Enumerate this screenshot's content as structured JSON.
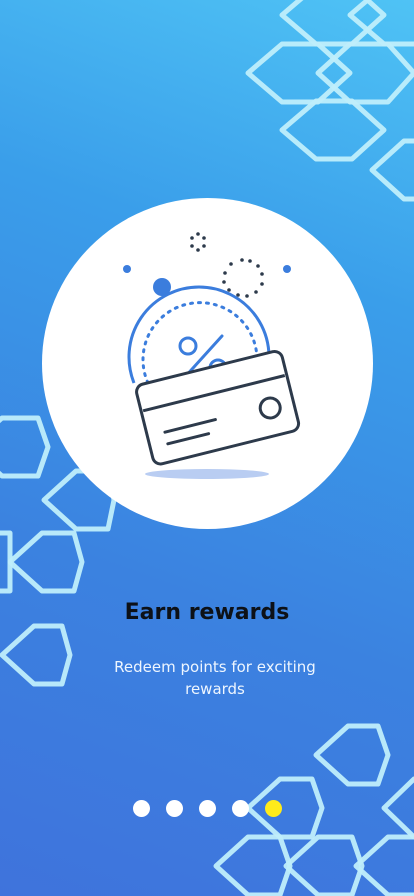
{
  "onboarding": {
    "title": "Earn rewards",
    "subtitle": "Redeem points for exciting rewards",
    "illustration_icon": "discount-card-icon",
    "pagination": {
      "total": 5,
      "active_index": 4,
      "active_color": "#ffeb1a",
      "inactive_color": "#ffffff"
    }
  },
  "colors": {
    "background_top": "#4fc3f5",
    "background_bottom": "#3f73dc",
    "hexagon_stroke": "#bfeefb",
    "accent_blue": "#3b7ddd",
    "ink": "#2d3a4b"
  }
}
